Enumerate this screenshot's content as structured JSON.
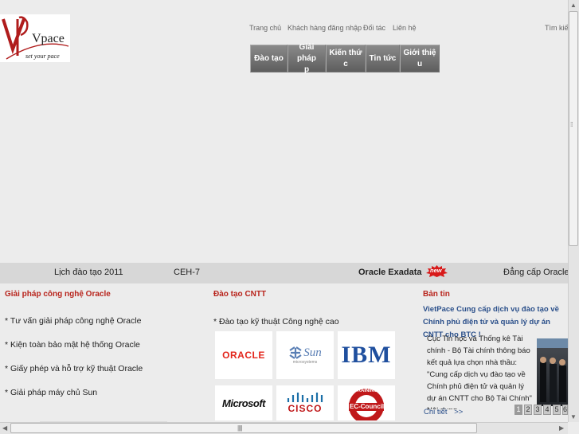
{
  "logo": {
    "letters": "Vpace",
    "tagline": "set your pace"
  },
  "top_links": [
    "Trang chủ",
    "Khách hàng đăng nhập",
    "Đối tác",
    "Liên hệ",
    "Tìm kiếm"
  ],
  "menu": [
    {
      "line1": "Đào tạo",
      "line2": ""
    },
    {
      "line1": "Giải pháp",
      "line2": "p"
    },
    {
      "line1": "Kiến thứ",
      "line2": "c"
    },
    {
      "line1": "Tin tức",
      "line2": ""
    },
    {
      "line1": "Giới thiệ",
      "line2": "u"
    }
  ],
  "marquee": {
    "items": [
      "Lịch đào tạo 2011",
      "CEH-7",
      "Oracle Exadata",
      "Đẳng cấp Oracle"
    ],
    "new_badge": "new"
  },
  "solutions": {
    "title": "Giải pháp công nghệ Oracle",
    "items": [
      "* Tư vấn giải pháp công nghệ Oracle",
      "* Kiện toàn bảo mật hệ thống Oracle",
      "* Giấy phép và hỗ trợ kỹ thuật Oracle",
      "* Giải pháp máy chủ Sun"
    ]
  },
  "training": {
    "title": "Đào tạo CNTT",
    "items": [
      "* Đào tạo kỹ thuật Công nghệ cao"
    ],
    "partners": [
      {
        "icon": "oracle-logo",
        "label": "ORACLE",
        "color": "#e3261c"
      },
      {
        "icon": "sun-logo",
        "label": "Sun",
        "sub": "microsystems",
        "color": "#5a7fb5"
      },
      {
        "icon": "ibm-logo",
        "label": "IBM",
        "color": "#1f4f9e"
      },
      {
        "icon": "microsoft-logo",
        "label": "Microsoft",
        "color": "#111111"
      },
      {
        "icon": "cisco-logo",
        "label": "CISCO",
        "color": "#1b6fa8"
      },
      {
        "icon": "ec-council-logo",
        "label": "EC-Council",
        "ring_text": "TRAINING",
        "color": "#c0181a"
      }
    ]
  },
  "news": {
    "title": "Bản tin",
    "headline": "VietPace Cung cấp dịch vụ đào tạo về Chính phủ điện tử và quản lý dự án CNTT cho BTC !",
    "body": "Cục Tin học và Thống kê Tài chính - Bộ Tài chính thông báo kết quả lựa chọn nhà thầu: \"Cung cấp dịch vụ đào tạo về Chính phủ điện tử và quản lý dự án CNTT cho Bộ Tài Chính\" Nội dung",
    "more_label": "Chi tiết",
    "more_arrow": ">>",
    "pages": [
      "1",
      "2",
      "3",
      "4",
      "5",
      "6"
    ],
    "active_page": "1"
  },
  "colors": {
    "section_title": "#b8241c",
    "link": "#2a4f8a",
    "menu_bg": "#6e6e6e"
  }
}
